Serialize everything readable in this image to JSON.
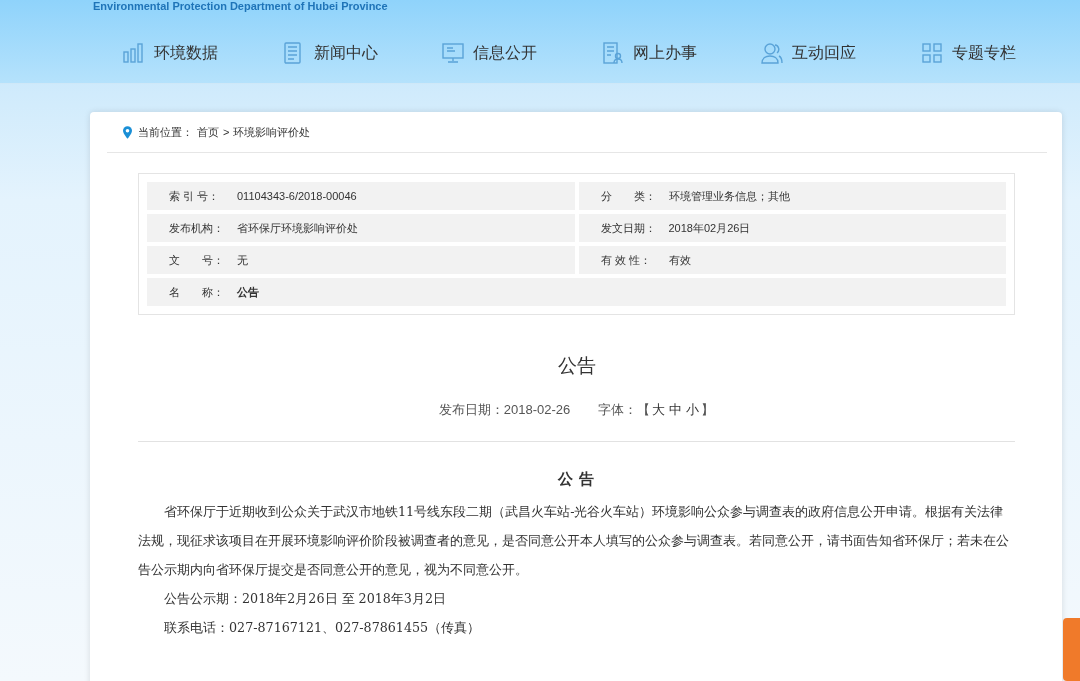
{
  "header": {
    "subtitle": "Environmental Protection Department of Hubei Province"
  },
  "nav": [
    {
      "label": "环境数据",
      "kind": "chart"
    },
    {
      "label": "新闻中心",
      "kind": "news"
    },
    {
      "label": "信息公开",
      "kind": "monitor"
    },
    {
      "label": "网上办事",
      "kind": "form"
    },
    {
      "label": "互动回应",
      "kind": "people"
    },
    {
      "label": "专题专栏",
      "kind": "grid"
    }
  ],
  "breadcrumb": {
    "label": "当前位置：",
    "items": [
      "首页",
      "环境影响评价处"
    ],
    "separator": ">"
  },
  "info": [
    {
      "label": "索 引 号：",
      "value": "01104343-6/2018-00046",
      "bold": false,
      "wide": false
    },
    {
      "label": "分　　类：",
      "value": "环境管理业务信息；其他",
      "bold": false,
      "wide": false
    },
    {
      "label": "发布机构：",
      "value": "省环保厅环境影响评价处",
      "bold": false,
      "wide": false
    },
    {
      "label": "发文日期：",
      "value": "2018年02月26日",
      "bold": false,
      "wide": false
    },
    {
      "label": "文　　号：",
      "value": "无",
      "bold": false,
      "wide": false
    },
    {
      "label": "有 效 性：",
      "value": "有效",
      "bold": false,
      "wide": false
    },
    {
      "label": "名　　称：",
      "value": "公告",
      "bold": true,
      "wide": true
    }
  ],
  "article": {
    "title": "公告",
    "date": "发布日期：2018-02-26",
    "font_label": "字体：",
    "font_open": "【",
    "font_sizes": [
      "大",
      "中",
      "小"
    ],
    "font_close": "】",
    "heading": "公 告",
    "paragraphs": [
      "省环保厅于近期收到公众关于武汉市地铁11号线东段二期（武昌火车站-光谷火车站）环境影响公众参与调查表的政府信息公开申请。根据有关法律法规，现征求该项目在开展环境影响评价阶段被调查者的意见，是否同意公开本人填写的公众参与调查表。若同意公开，请书面告知省环保厅；若未在公告公示期内向省环保厅提交是否同意公开的意见，视为不同意公开。",
      "公告公示期：2018年2月26日 至 2018年3月2日",
      "联系电话：027-87167121、027-87861455（传真）"
    ]
  }
}
